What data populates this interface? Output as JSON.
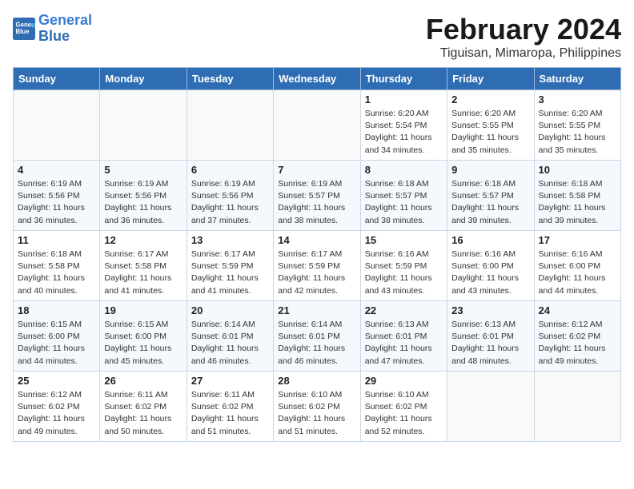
{
  "header": {
    "logo_line1": "General",
    "logo_line2": "Blue",
    "title": "February 2024",
    "subtitle": "Tiguisan, Mimaropa, Philippines"
  },
  "days_of_week": [
    "Sunday",
    "Monday",
    "Tuesday",
    "Wednesday",
    "Thursday",
    "Friday",
    "Saturday"
  ],
  "weeks": [
    [
      {
        "day": "",
        "sunrise": "",
        "sunset": "",
        "daylight": ""
      },
      {
        "day": "",
        "sunrise": "",
        "sunset": "",
        "daylight": ""
      },
      {
        "day": "",
        "sunrise": "",
        "sunset": "",
        "daylight": ""
      },
      {
        "day": "",
        "sunrise": "",
        "sunset": "",
        "daylight": ""
      },
      {
        "day": "1",
        "sunrise": "Sunrise: 6:20 AM",
        "sunset": "Sunset: 5:54 PM",
        "daylight": "Daylight: 11 hours and 34 minutes."
      },
      {
        "day": "2",
        "sunrise": "Sunrise: 6:20 AM",
        "sunset": "Sunset: 5:55 PM",
        "daylight": "Daylight: 11 hours and 35 minutes."
      },
      {
        "day": "3",
        "sunrise": "Sunrise: 6:20 AM",
        "sunset": "Sunset: 5:55 PM",
        "daylight": "Daylight: 11 hours and 35 minutes."
      }
    ],
    [
      {
        "day": "4",
        "sunrise": "Sunrise: 6:19 AM",
        "sunset": "Sunset: 5:56 PM",
        "daylight": "Daylight: 11 hours and 36 minutes."
      },
      {
        "day": "5",
        "sunrise": "Sunrise: 6:19 AM",
        "sunset": "Sunset: 5:56 PM",
        "daylight": "Daylight: 11 hours and 36 minutes."
      },
      {
        "day": "6",
        "sunrise": "Sunrise: 6:19 AM",
        "sunset": "Sunset: 5:56 PM",
        "daylight": "Daylight: 11 hours and 37 minutes."
      },
      {
        "day": "7",
        "sunrise": "Sunrise: 6:19 AM",
        "sunset": "Sunset: 5:57 PM",
        "daylight": "Daylight: 11 hours and 38 minutes."
      },
      {
        "day": "8",
        "sunrise": "Sunrise: 6:18 AM",
        "sunset": "Sunset: 5:57 PM",
        "daylight": "Daylight: 11 hours and 38 minutes."
      },
      {
        "day": "9",
        "sunrise": "Sunrise: 6:18 AM",
        "sunset": "Sunset: 5:57 PM",
        "daylight": "Daylight: 11 hours and 39 minutes."
      },
      {
        "day": "10",
        "sunrise": "Sunrise: 6:18 AM",
        "sunset": "Sunset: 5:58 PM",
        "daylight": "Daylight: 11 hours and 39 minutes."
      }
    ],
    [
      {
        "day": "11",
        "sunrise": "Sunrise: 6:18 AM",
        "sunset": "Sunset: 5:58 PM",
        "daylight": "Daylight: 11 hours and 40 minutes."
      },
      {
        "day": "12",
        "sunrise": "Sunrise: 6:17 AM",
        "sunset": "Sunset: 5:58 PM",
        "daylight": "Daylight: 11 hours and 41 minutes."
      },
      {
        "day": "13",
        "sunrise": "Sunrise: 6:17 AM",
        "sunset": "Sunset: 5:59 PM",
        "daylight": "Daylight: 11 hours and 41 minutes."
      },
      {
        "day": "14",
        "sunrise": "Sunrise: 6:17 AM",
        "sunset": "Sunset: 5:59 PM",
        "daylight": "Daylight: 11 hours and 42 minutes."
      },
      {
        "day": "15",
        "sunrise": "Sunrise: 6:16 AM",
        "sunset": "Sunset: 5:59 PM",
        "daylight": "Daylight: 11 hours and 43 minutes."
      },
      {
        "day": "16",
        "sunrise": "Sunrise: 6:16 AM",
        "sunset": "Sunset: 6:00 PM",
        "daylight": "Daylight: 11 hours and 43 minutes."
      },
      {
        "day": "17",
        "sunrise": "Sunrise: 6:16 AM",
        "sunset": "Sunset: 6:00 PM",
        "daylight": "Daylight: 11 hours and 44 minutes."
      }
    ],
    [
      {
        "day": "18",
        "sunrise": "Sunrise: 6:15 AM",
        "sunset": "Sunset: 6:00 PM",
        "daylight": "Daylight: 11 hours and 44 minutes."
      },
      {
        "day": "19",
        "sunrise": "Sunrise: 6:15 AM",
        "sunset": "Sunset: 6:00 PM",
        "daylight": "Daylight: 11 hours and 45 minutes."
      },
      {
        "day": "20",
        "sunrise": "Sunrise: 6:14 AM",
        "sunset": "Sunset: 6:01 PM",
        "daylight": "Daylight: 11 hours and 46 minutes."
      },
      {
        "day": "21",
        "sunrise": "Sunrise: 6:14 AM",
        "sunset": "Sunset: 6:01 PM",
        "daylight": "Daylight: 11 hours and 46 minutes."
      },
      {
        "day": "22",
        "sunrise": "Sunrise: 6:13 AM",
        "sunset": "Sunset: 6:01 PM",
        "daylight": "Daylight: 11 hours and 47 minutes."
      },
      {
        "day": "23",
        "sunrise": "Sunrise: 6:13 AM",
        "sunset": "Sunset: 6:01 PM",
        "daylight": "Daylight: 11 hours and 48 minutes."
      },
      {
        "day": "24",
        "sunrise": "Sunrise: 6:12 AM",
        "sunset": "Sunset: 6:02 PM",
        "daylight": "Daylight: 11 hours and 49 minutes."
      }
    ],
    [
      {
        "day": "25",
        "sunrise": "Sunrise: 6:12 AM",
        "sunset": "Sunset: 6:02 PM",
        "daylight": "Daylight: 11 hours and 49 minutes."
      },
      {
        "day": "26",
        "sunrise": "Sunrise: 6:11 AM",
        "sunset": "Sunset: 6:02 PM",
        "daylight": "Daylight: 11 hours and 50 minutes."
      },
      {
        "day": "27",
        "sunrise": "Sunrise: 6:11 AM",
        "sunset": "Sunset: 6:02 PM",
        "daylight": "Daylight: 11 hours and 51 minutes."
      },
      {
        "day": "28",
        "sunrise": "Sunrise: 6:10 AM",
        "sunset": "Sunset: 6:02 PM",
        "daylight": "Daylight: 11 hours and 51 minutes."
      },
      {
        "day": "29",
        "sunrise": "Sunrise: 6:10 AM",
        "sunset": "Sunset: 6:02 PM",
        "daylight": "Daylight: 11 hours and 52 minutes."
      },
      {
        "day": "",
        "sunrise": "",
        "sunset": "",
        "daylight": ""
      },
      {
        "day": "",
        "sunrise": "",
        "sunset": "",
        "daylight": ""
      }
    ]
  ]
}
